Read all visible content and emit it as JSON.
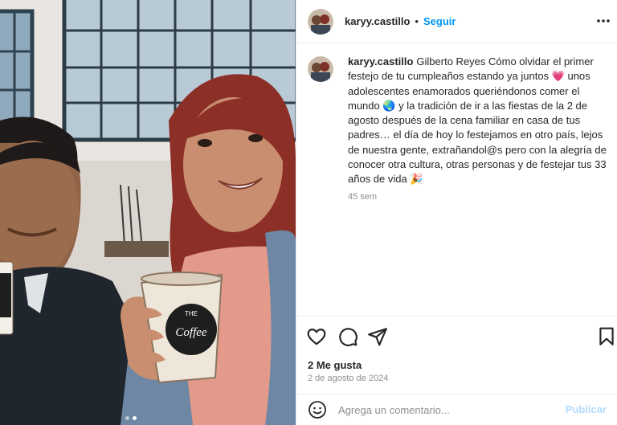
{
  "post": {
    "author": {
      "username": "karyy.castillo",
      "separator": "•",
      "follow_label": "Seguir"
    },
    "caption": {
      "username": "karyy.castillo",
      "text": "Gilberto Reyes Cómo olvidar el primer festejo de tu cumpleaños estando ya juntos 💗 unos adolescentes enamorados queriéndonos comer el mundo 🌏 y la tradición de ir a las fiestas de la 2 de agosto después de la cena familiar en casa de tus padres… el día de hoy lo festejamos en otro país, lejos de nuestra gente, extrañandol@s pero con la alegría de conocer otra cultura, otras personas y de festejar tus 33 años de vida 🎉",
      "time_ago": "45 sem"
    },
    "likes": "2 Me gusta",
    "date": "2 de agosto de 2024",
    "comment": {
      "placeholder": "Agrega un comentario...",
      "publish_label": "Publicar"
    },
    "cup_text": {
      "top": "THE",
      "brand": "Coffee"
    },
    "icons": {
      "more": "more-options-icon",
      "like": "heart-icon",
      "comment": "comment-bubble-icon",
      "share": "paper-plane-icon",
      "save": "bookmark-icon",
      "emoji": "smiley-icon"
    },
    "carousel": {
      "slides": 2,
      "active": 2
    },
    "colors": {
      "accent": "#0095f6",
      "publish_disabled": "#b3dbff",
      "muted": "#8e8e8e"
    }
  }
}
